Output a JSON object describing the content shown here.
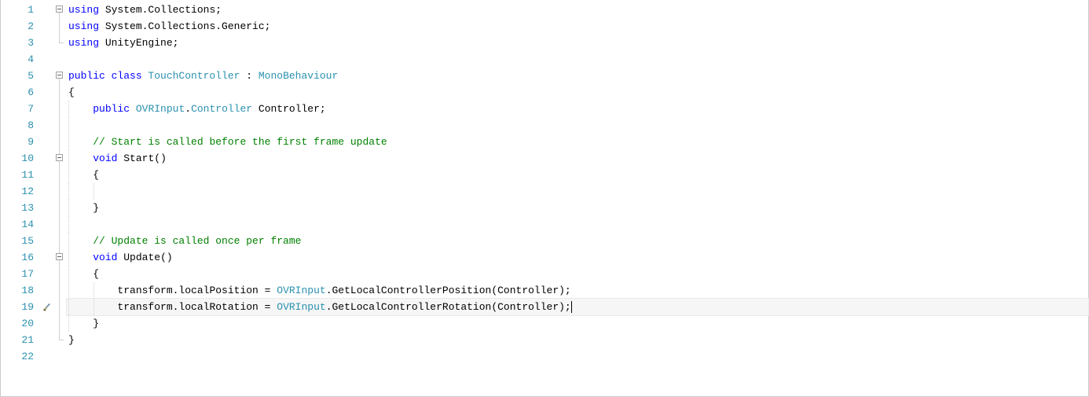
{
  "line_numbers": [
    "1",
    "2",
    "3",
    "4",
    "5",
    "6",
    "7",
    "8",
    "9",
    "10",
    "11",
    "12",
    "13",
    "14",
    "15",
    "16",
    "17",
    "18",
    "19",
    "20",
    "21",
    "22"
  ],
  "code": {
    "l1": {
      "kw_using": "using",
      "ns": " System.Collections;"
    },
    "l2": {
      "kw_using": "using",
      "ns": " System.Collections.Generic;"
    },
    "l3": {
      "kw_using": "using",
      "ns": " UnityEngine;"
    },
    "l4": "",
    "l5": {
      "kw_public": "public",
      "kw_class": " class ",
      "name": "TouchController",
      "colon": " : ",
      "base": "MonoBehaviour"
    },
    "l6": "{",
    "l7": {
      "indent": "    ",
      "kw_public": "public",
      "sp": " ",
      "type": "OVRInput",
      "dot": ".",
      "type2": "Controller",
      "rest": " Controller;"
    },
    "l8": "",
    "l9": {
      "indent": "    ",
      "comment": "// Start is called before the first frame update"
    },
    "l10": {
      "indent": "    ",
      "kw_void": "void",
      "sp": " ",
      "name": "Start",
      "paren": "()"
    },
    "l11": {
      "indent": "    ",
      "brace": "{"
    },
    "l12": "",
    "l13": {
      "indent": "    ",
      "brace": "}"
    },
    "l14": "",
    "l15": {
      "indent": "    ",
      "comment": "// Update is called once per frame"
    },
    "l16": {
      "indent": "    ",
      "kw_void": "void",
      "sp": " ",
      "name": "Update",
      "paren": "()"
    },
    "l17": {
      "indent": "    ",
      "brace": "{"
    },
    "l18": {
      "indent": "        ",
      "txt1": "transform.localPosition = ",
      "type": "OVRInput",
      "txt2": ".GetLocalControllerPosition(Controller);"
    },
    "l19": {
      "indent": "        ",
      "txt1": "transform.localRotation = ",
      "type": "OVRInput",
      "txt2": ".GetLocalControllerRotation(Controller);"
    },
    "l20": {
      "indent": "    ",
      "brace": "}"
    },
    "l21": "}",
    "l22": ""
  },
  "markers": {
    "l19": "screwdriver-icon"
  },
  "fold": {
    "l1": "box",
    "l5": "box",
    "l10": "box",
    "l16": "box"
  },
  "active_line": 19
}
